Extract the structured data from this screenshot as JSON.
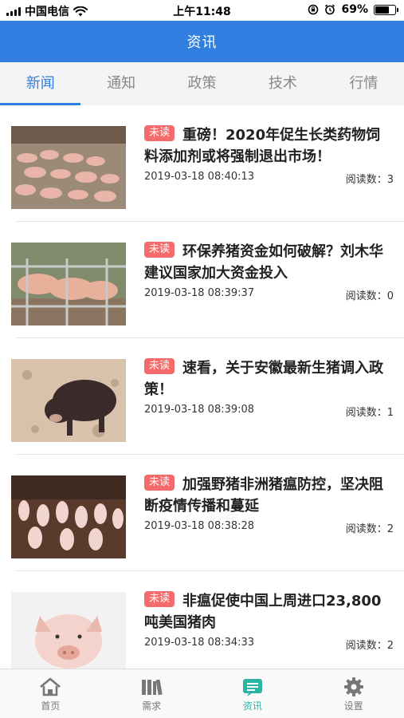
{
  "status_bar": {
    "carrier": "中国电信",
    "time": "上午11:48",
    "battery": "69%",
    "battery_level": 0.69
  },
  "header": {
    "title": "资讯"
  },
  "tabs": [
    {
      "label": "新闻",
      "active": true
    },
    {
      "label": "通知",
      "active": false
    },
    {
      "label": "政策",
      "active": false
    },
    {
      "label": "技术",
      "active": false
    },
    {
      "label": "行情",
      "active": false
    }
  ],
  "news": [
    {
      "badge": "未读",
      "title": "重磅！2020年促生长类药物饲料添加剂或将强制退出市场！",
      "time": "2019-03-18 08:40:13",
      "reads": "阅读数：3"
    },
    {
      "badge": "未读",
      "title": "环保养猪资金如何破解？刘木华建议国家加大资金投入",
      "time": "2019-03-18 08:39:37",
      "reads": "阅读数：0"
    },
    {
      "badge": "未读",
      "title": "速看，关于安徽最新生猪调入政策！",
      "time": "2019-03-18 08:39:08",
      "reads": "阅读数：1"
    },
    {
      "badge": "未读",
      "title": "加强野猪非洲猪瘟防控，坚决阻断疫情传播和蔓延",
      "time": "2019-03-18 08:38:28",
      "reads": "阅读数：2"
    },
    {
      "badge": "未读",
      "title": "非瘟促使中国上周进口23,800吨美国猪肉",
      "time": "2019-03-18 08:34:33",
      "reads": "阅读数：2"
    }
  ],
  "tabbar": [
    {
      "label": "首页",
      "icon": "home-icon",
      "active": false
    },
    {
      "label": "需求",
      "icon": "books-icon",
      "active": false
    },
    {
      "label": "资讯",
      "icon": "news-icon",
      "active": true
    },
    {
      "label": "设置",
      "icon": "gear-icon",
      "active": false
    }
  ],
  "colors": {
    "primary": "#2f7ee0",
    "badge": "#f56b6b",
    "tabbar_active": "#2bb5a5"
  }
}
